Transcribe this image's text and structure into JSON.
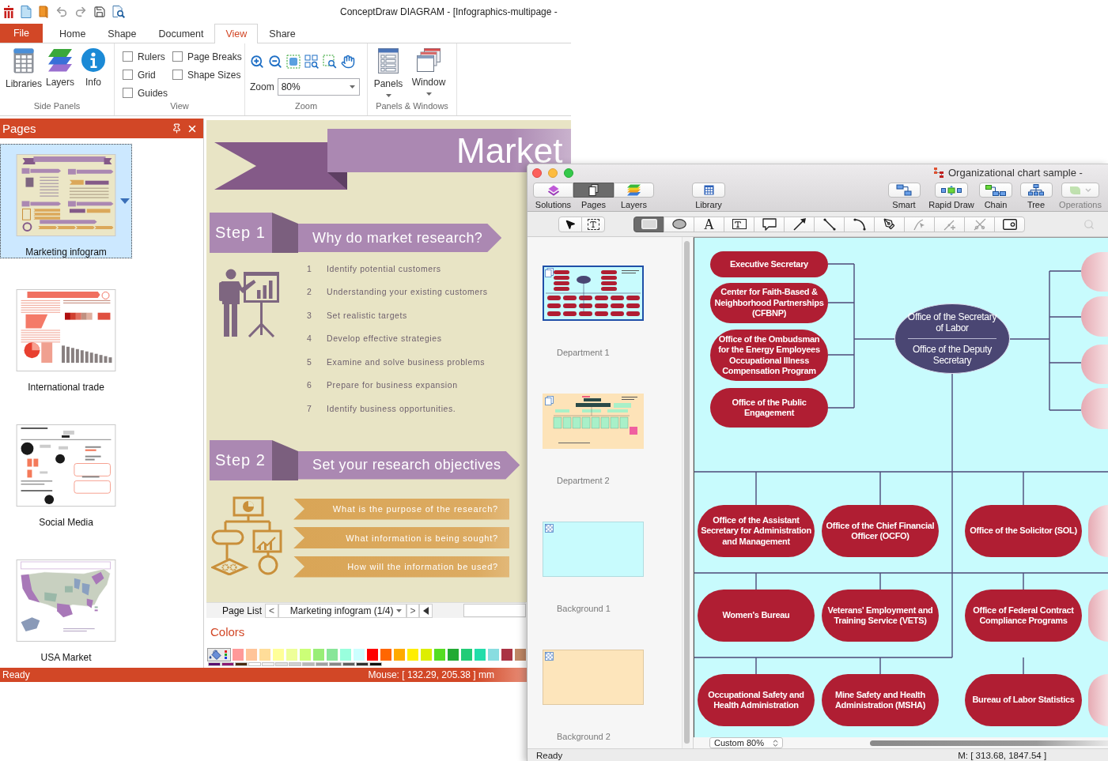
{
  "editor": {
    "title": "ConceptDraw DIAGRAM - [Infographics-multipage -",
    "tabs": [
      {
        "label": "File",
        "kind": "file",
        "selected": false
      },
      {
        "label": "Home",
        "kind": "tab",
        "selected": false
      },
      {
        "label": "Shape",
        "kind": "tab",
        "selected": false
      },
      {
        "label": "Document",
        "kind": "tab",
        "selected": false
      },
      {
        "label": "View",
        "kind": "tab",
        "selected": true
      },
      {
        "label": "Share",
        "kind": "tab",
        "selected": false
      }
    ],
    "ribbon": {
      "side_panels": {
        "label": "Side Panels",
        "buttons": [
          {
            "label": "Libraries",
            "kind": "libraries"
          },
          {
            "label": "Layers",
            "kind": "layers"
          },
          {
            "label": "Info",
            "kind": "info"
          }
        ]
      },
      "view": {
        "label": "View",
        "checkboxes": [
          {
            "label": "Rulers",
            "checked": false
          },
          {
            "label": "Page Breaks",
            "checked": false
          },
          {
            "label": "Grid",
            "checked": false
          },
          {
            "label": "Shape Sizes",
            "checked": false
          },
          {
            "label": "Guides",
            "checked": false
          }
        ]
      },
      "zoom": {
        "label": "Zoom",
        "field_label": "Zoom",
        "value": "80%"
      },
      "panels_windows": {
        "label": "Panels & Windows",
        "buttons": [
          {
            "label": "Panels",
            "kind": "panels"
          },
          {
            "label": "Window",
            "kind": "window"
          }
        ]
      }
    },
    "pages_panel": {
      "title": "Pages",
      "pages": [
        {
          "label": "Marketing infogram",
          "kind": "infographic",
          "selected": true
        },
        {
          "label": "International trade",
          "kind": "trade",
          "selected": false
        },
        {
          "label": "Social Media",
          "kind": "social",
          "selected": false
        },
        {
          "label": "USA Market",
          "kind": "map",
          "selected": false
        }
      ]
    },
    "canvas": {
      "title": "Market",
      "steps": [
        {
          "kind": "list",
          "label": "Step 1",
          "heading": "Why do market research?",
          "items": [
            {
              "number": "1",
              "text": "Identify potential customers"
            },
            {
              "number": "2",
              "text": "Understanding your existing customers"
            },
            {
              "number": "3",
              "text": "Set realistic targets"
            },
            {
              "number": "4",
              "text": "Develop effective strategies"
            },
            {
              "number": "5",
              "text": "Examine and solve business problems"
            },
            {
              "number": "6",
              "text": "Prepare for business expansion"
            },
            {
              "number": "7",
              "text": "Identify business opportunities."
            }
          ]
        },
        {
          "kind": "questions",
          "label": "Step 2",
          "heading": "Set your research objectives",
          "items": [
            {
              "text": "What is the purpose of the research?"
            },
            {
              "text": "What information is being sought?"
            },
            {
              "text": "How will the information be used?"
            }
          ]
        }
      ]
    },
    "page_list": {
      "label": "Page List",
      "previous": "<",
      "current": "Marketing infogram (1/4)",
      "next": ">"
    },
    "colors_panel": {
      "title": "Colors",
      "swatches": [
        {
          "color": "#ff9999"
        },
        {
          "color": "#ffc499"
        },
        {
          "color": "#ffdd99"
        },
        {
          "color": "#ffff99"
        },
        {
          "color": "#eeff99"
        },
        {
          "color": "#ccff77"
        },
        {
          "color": "#99ee77"
        },
        {
          "color": "#88e699"
        },
        {
          "color": "#99ffdd"
        },
        {
          "color": "#ccffff"
        },
        {
          "color": "#ff0000"
        },
        {
          "color": "#ff6600"
        },
        {
          "color": "#ffaa00"
        },
        {
          "color": "#ffee00"
        },
        {
          "color": "#ddee00"
        },
        {
          "color": "#55dd22"
        },
        {
          "color": "#22aa33"
        },
        {
          "color": "#22cc77"
        },
        {
          "color": "#22ddaa"
        },
        {
          "color": "#88dde0"
        },
        {
          "color": "#aa3344"
        },
        {
          "color": "#c08866"
        }
      ],
      "more_swatches": [
        {
          "color": "#5a1070"
        },
        {
          "color": "#8b1a75"
        },
        {
          "color": "#4a2a10"
        },
        {
          "color": "#ffffff"
        },
        {
          "color": "#f2f2f2"
        },
        {
          "color": "#e0e0e0"
        },
        {
          "color": "#d0d0d0"
        },
        {
          "color": "#b8b8b8"
        },
        {
          "color": "#a0a0a0"
        },
        {
          "color": "#888888"
        },
        {
          "color": "#606060"
        },
        {
          "color": "#303030"
        },
        {
          "color": "#101010"
        }
      ]
    },
    "status_bar": {
      "status": "Ready",
      "mouse": "Mouse: [ 132.29, 205.38 ] mm"
    }
  },
  "mac_editor": {
    "title": "Organizational chart sample -",
    "panel_buttons": [
      {
        "label": "Solutions",
        "kind": "solutions",
        "selected": false
      },
      {
        "label": "Pages",
        "kind": "pages",
        "selected": true
      },
      {
        "label": "Layers",
        "kind": "layers",
        "selected": false
      }
    ],
    "library_button": {
      "label": "Library"
    },
    "mode_buttons": [
      {
        "label": "Smart",
        "kind": "smart",
        "disabled": false
      },
      {
        "label": "Rapid Draw",
        "kind": "rapid-draw",
        "disabled": false
      },
      {
        "label": "Chain",
        "kind": "chain",
        "disabled": false
      },
      {
        "label": "Tree",
        "kind": "tree",
        "disabled": false
      },
      {
        "label": "Operations",
        "kind": "operations",
        "disabled": true
      }
    ],
    "select_tools": [
      {
        "kind": "pointer",
        "selected": false
      },
      {
        "kind": "text-select",
        "selected": false
      }
    ],
    "drawing_tools": [
      {
        "kind": "rectangle",
        "selected": true,
        "disabled": false
      },
      {
        "kind": "ellipse",
        "selected": false,
        "disabled": false
      },
      {
        "kind": "text",
        "glyph": "A",
        "selected": false,
        "disabled": false
      },
      {
        "kind": "text-box",
        "selected": false,
        "disabled": false
      },
      {
        "kind": "callout",
        "selected": false,
        "disabled": false
      },
      {
        "kind": "arrow",
        "selected": false,
        "disabled": false
      },
      {
        "kind": "line",
        "selected": false,
        "disabled": false
      },
      {
        "kind": "arc",
        "selected": false,
        "disabled": false
      },
      {
        "kind": "pen",
        "selected": false,
        "disabled": false
      },
      {
        "kind": "edit-points",
        "selected": false,
        "disabled": true
      },
      {
        "kind": "add-point",
        "selected": false,
        "disabled": true
      },
      {
        "kind": "delete-point",
        "selected": false,
        "disabled": true
      },
      {
        "kind": "frame",
        "selected": false,
        "disabled": false
      }
    ],
    "pages": [
      {
        "label": "Department 1",
        "kind": "org-chart",
        "selected": true
      },
      {
        "label": "Department 2",
        "kind": "org-chart-peach",
        "selected": false
      },
      {
        "label": "Background 1",
        "kind": "blank-cyan",
        "selected": false
      },
      {
        "label": "Background 2",
        "kind": "blank-peach",
        "selected": false
      }
    ],
    "org_chart": {
      "head": {
        "title": "Office of the Secretary of Labor",
        "subtitle": "Office of the Deputy Secretary"
      },
      "staff_offices": [
        {
          "kind": "office",
          "text": "Executive Secretary"
        },
        {
          "kind": "office",
          "text": "Center for Faith-Based & Neighborhood Partnerships (CFBNP)"
        },
        {
          "kind": "office",
          "text": "Office of the Ombudsman for the Energy Employees Occupational Illness Compensation Program"
        },
        {
          "kind": "office",
          "text": "Office of the Public Engagement"
        }
      ],
      "side_offices": [
        {
          "kind": "cut-off"
        },
        {
          "kind": "cut-off"
        },
        {
          "kind": "cut-off"
        },
        {
          "kind": "cut-off"
        }
      ],
      "agency_rows": [
        {
          "nodes": [
            {
              "kind": "office",
              "text": "Office of the Assistant Secretary for Administration and Management"
            },
            {
              "kind": "office",
              "text": "Office of the Chief Financial Officer (OCFO)"
            },
            {
              "kind": "office",
              "text": "Office of the Solicitor (SOL)"
            },
            {
              "kind": "cut-off"
            }
          ]
        },
        {
          "nodes": [
            {
              "kind": "office",
              "text": "Women's Bureau"
            },
            {
              "kind": "office",
              "text": "Veterans' Employment and Training Service (VETS)"
            },
            {
              "kind": "office",
              "text": "Office of Federal Contract Compliance Programs"
            },
            {
              "kind": "cut-off"
            }
          ]
        },
        {
          "nodes": [
            {
              "kind": "office",
              "text": "Occupational Safety and Health Administration"
            },
            {
              "kind": "office",
              "text": "Mine Safety and Health Administration (MSHA)"
            },
            {
              "kind": "office",
              "text": "Bureau of Labor Statistics"
            },
            {
              "kind": "cut-off"
            }
          ]
        }
      ]
    },
    "zoom": "Custom 80%",
    "status_bar": {
      "status": "Ready",
      "mouse": "M: [ 313.68, 1847.54 ]"
    }
  }
}
